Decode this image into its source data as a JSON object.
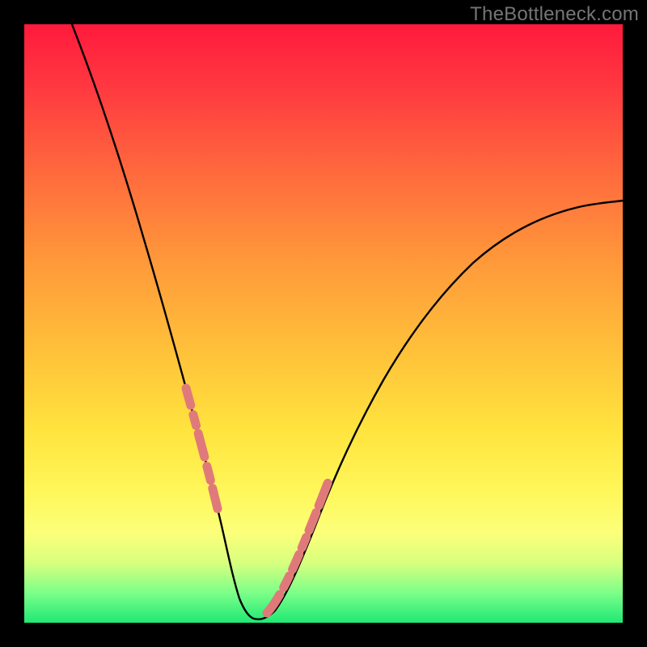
{
  "watermark": "TheBottleneck.com",
  "colors": {
    "background": "#000000",
    "curve": "#000000",
    "dash": "#e07a7a",
    "gradient_top": "#ff1a3c",
    "gradient_bottom": "#1fe874"
  },
  "chart_data": {
    "type": "line",
    "title": "",
    "xlabel": "",
    "ylabel": "",
    "xlim": [
      0,
      100
    ],
    "ylim": [
      0,
      100
    ],
    "grid": false,
    "legend": false,
    "note": "Bottleneck-style V-curve. No axis tick labels are shown; x and y values are estimated from pixel positions on a 0–100 normalized scale (0,0 at plot bottom-left).",
    "series": [
      {
        "name": "curve",
        "x": [
          8,
          12,
          16,
          20,
          24,
          26,
          28,
          30,
          32,
          34,
          35,
          36,
          37,
          38,
          40,
          42,
          44,
          46,
          50,
          55,
          60,
          65,
          70,
          75,
          80,
          85,
          90,
          95,
          100
        ],
        "y": [
          100,
          90,
          78,
          64,
          50,
          42,
          34,
          26,
          18,
          10,
          6,
          3,
          1,
          1,
          2,
          5,
          10,
          16,
          26,
          37,
          45,
          52,
          57,
          61,
          64,
          66,
          68,
          69,
          70
        ]
      }
    ],
    "dash_segments": {
      "description": "Approximate x-ranges (0–100 scale) where pink dashed overlay appears on the curve.",
      "ranges": [
        [
          27,
          35
        ],
        [
          38,
          48
        ]
      ]
    }
  }
}
